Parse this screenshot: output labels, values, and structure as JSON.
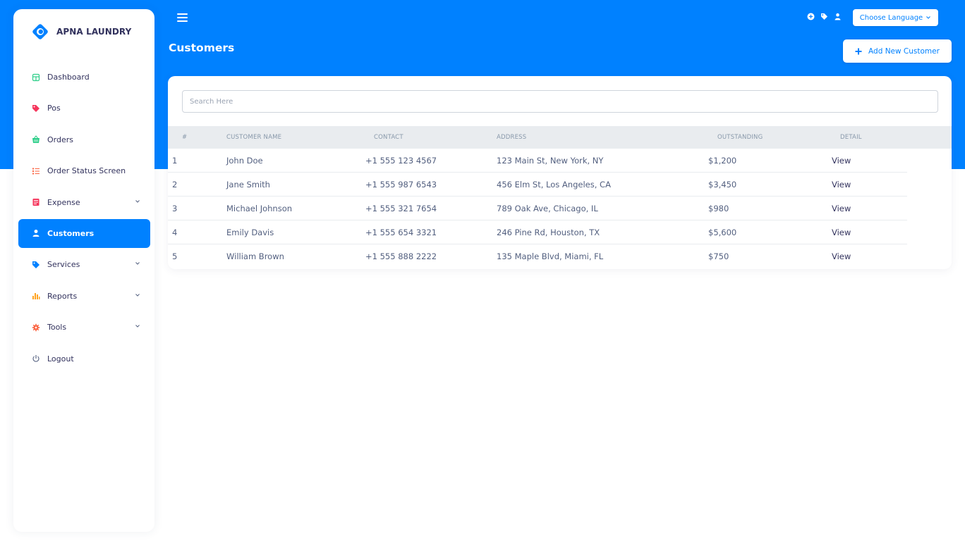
{
  "brand": {
    "name": "APNA LAUNDRY"
  },
  "sidebar": {
    "items": [
      {
        "label": "Dashboard",
        "icon": "dashboard-icon",
        "color": "#2dce89"
      },
      {
        "label": "Pos",
        "icon": "tag-icon",
        "color": "#f5365c"
      },
      {
        "label": "Orders",
        "icon": "basket-icon",
        "color": "#2dce89"
      },
      {
        "label": "Order Status Screen",
        "icon": "list-icon",
        "color": "#fb6340"
      },
      {
        "label": "Expense",
        "icon": "receipt-icon",
        "color": "#f5365c",
        "submenu": true
      },
      {
        "label": "Customers",
        "icon": "user-icon",
        "color": "#ffffff",
        "active": true
      },
      {
        "label": "Services",
        "icon": "tag-icon",
        "color": "#0081ff",
        "submenu": true
      },
      {
        "label": "Reports",
        "icon": "bar-chart-icon",
        "color": "#ffa21d",
        "submenu": true
      },
      {
        "label": "Tools",
        "icon": "gear-icon",
        "color": "#fb6340",
        "submenu": true
      },
      {
        "label": "Logout",
        "icon": "power-icon",
        "color": "#525f7f"
      }
    ]
  },
  "header": {
    "language_label": "Choose Language",
    "icons": [
      "plus-circle-icon",
      "tag-icon",
      "user-icon"
    ]
  },
  "page": {
    "title": "Customers",
    "add_button_label": "Add New Customer"
  },
  "search": {
    "placeholder": "Search Here",
    "value": ""
  },
  "table": {
    "headers": [
      "#",
      "CUSTOMER NAME",
      "CONTACT",
      "ADDRESS",
      "OUTSTANDING",
      "DETAIL"
    ],
    "rows": [
      {
        "no": "1",
        "name": "John Doe",
        "contact": "+1 555 123 4567",
        "address": "123 Main St, New York, NY",
        "outstanding": "$1,200",
        "detail": "View"
      },
      {
        "no": "2",
        "name": "Jane Smith",
        "contact": "+1 555 987 6543",
        "address": "456 Elm St, Los Angeles, CA",
        "outstanding": "$3,450",
        "detail": "View"
      },
      {
        "no": "3",
        "name": "Michael Johnson",
        "contact": "+1 555 321 7654",
        "address": "789 Oak Ave, Chicago, IL",
        "outstanding": "$980",
        "detail": "View"
      },
      {
        "no": "4",
        "name": "Emily Davis",
        "contact": "+1 555 654 3321",
        "address": "246 Pine Rd, Houston, TX",
        "outstanding": "$5,600",
        "detail": "View"
      },
      {
        "no": "5",
        "name": "William Brown",
        "contact": "+1 555 888 2222",
        "address": "135 Maple Blvd, Miami, FL",
        "outstanding": "$750",
        "detail": "View"
      }
    ]
  },
  "colors": {
    "accent": "#0081ff",
    "background": "#ffffff",
    "text": "#525f7f"
  }
}
